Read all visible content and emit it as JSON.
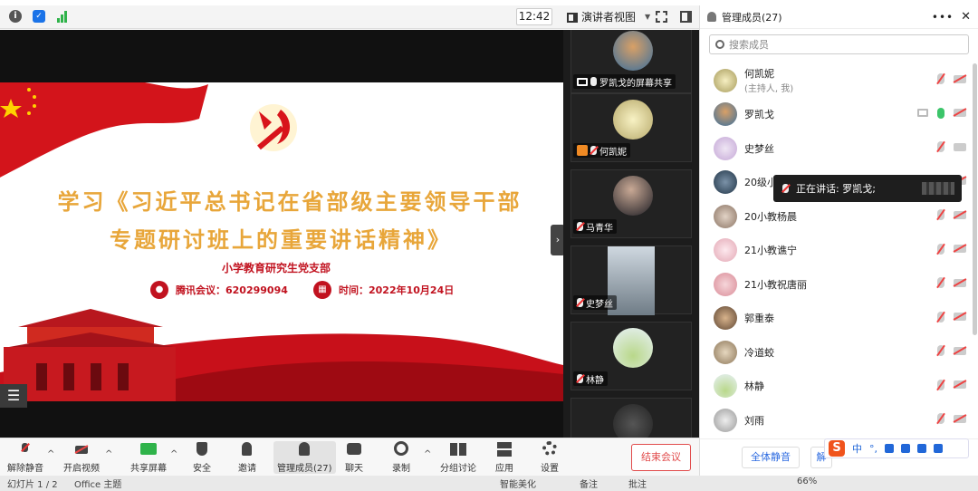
{
  "topbar": {
    "clock": "12:42",
    "view_mode": "演讲者视图"
  },
  "slide": {
    "title": "学习《习近平总书记在省部级主要领导干部",
    "subtitle": "专题研讨班上的重要讲话精神》",
    "org": "小学教育研究生党支部",
    "meeting_label": "腾讯会议：620299094",
    "time_label": "时间：2022年10月24日"
  },
  "tiles": [
    {
      "name": "罗凯戈的屏幕共享"
    },
    {
      "name": "何凯妮"
    },
    {
      "name": "马青华"
    },
    {
      "name": "史梦丝"
    },
    {
      "name": "林静"
    }
  ],
  "panel": {
    "title": "管理成员(27)",
    "search_placeholder": "搜索成员",
    "members": [
      {
        "name": "何凯妮",
        "sub": "(主持人, 我)"
      },
      {
        "name": "罗凯戈",
        "sub": ""
      },
      {
        "name": "史梦丝",
        "sub": ""
      },
      {
        "name": "20级小",
        "sub": ""
      },
      {
        "name": "20小教杨晨",
        "sub": ""
      },
      {
        "name": "21小教谯宁",
        "sub": ""
      },
      {
        "name": "21小教祝唐丽",
        "sub": ""
      },
      {
        "name": "郭重泰",
        "sub": ""
      },
      {
        "name": "冷道蛟",
        "sub": ""
      },
      {
        "name": "林静",
        "sub": ""
      },
      {
        "name": "刘雨",
        "sub": ""
      }
    ],
    "speaking": "正在讲话: 罗凯戈;",
    "mute_all": "全体静音",
    "unmute_all_partial": "解"
  },
  "ime": {
    "lang": "中",
    "punct": "°,"
  },
  "toolbar": {
    "unmute": "解除静音",
    "start_video": "开启视频",
    "share_screen": "共享屏幕",
    "security": "安全",
    "invite": "邀请",
    "manage_members": "管理成员(27)",
    "chat": "聊天",
    "record": "录制",
    "breakout": "分组讨论",
    "apps": "应用",
    "settings": "设置",
    "end_meeting": "结束会议"
  },
  "statusbar": {
    "slide_info": "幻灯片 1 / 2",
    "theme": "Office 主题",
    "smart": "智能美化",
    "notes": "备注",
    "comments": "批注",
    "zoom": "66%"
  },
  "colors": {
    "accent_red": "#c1121f",
    "title_gold": "#e8a63a",
    "end_red": "#e14b4b",
    "link_blue": "#2d6be0"
  }
}
